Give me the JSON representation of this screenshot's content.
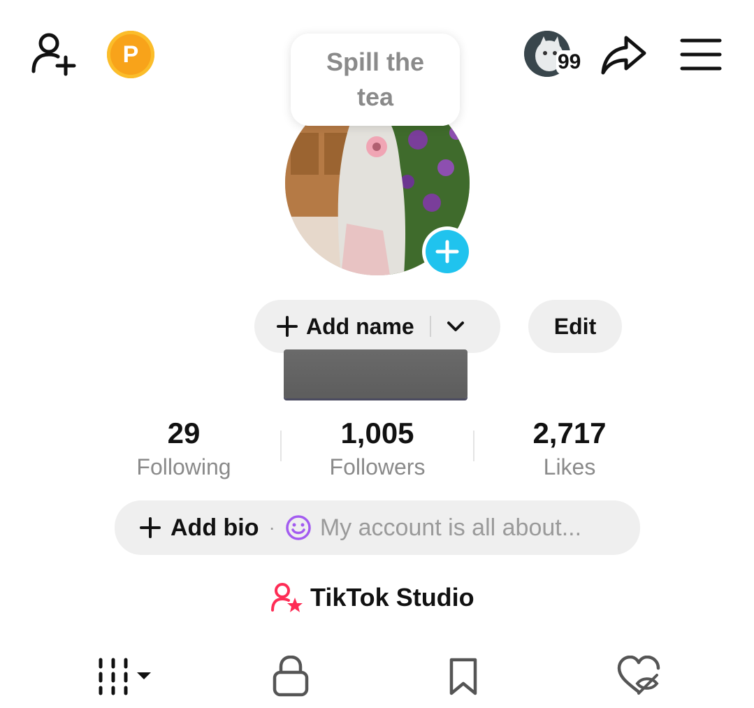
{
  "tooltip": {
    "text": "Spill the tea"
  },
  "header": {
    "story_count": "99"
  },
  "profile": {
    "add_name_label": "Add name",
    "edit_label": "Edit"
  },
  "stats": [
    {
      "value": "29",
      "label": "Following"
    },
    {
      "value": "1,005",
      "label": "Followers"
    },
    {
      "value": "2,717",
      "label": "Likes"
    }
  ],
  "bio": {
    "add_label": "Add bio",
    "separator": "·",
    "placeholder": "My account is all about..."
  },
  "studio": {
    "label": "TikTok Studio"
  },
  "colors": {
    "accent_blue": "#20c3ee",
    "coin_orange": "#f8a31a",
    "studio_pink": "#fe2c55",
    "emoji_purple": "#a35cf0"
  },
  "icons": {
    "top": [
      "add-user-icon",
      "coin-icon",
      "share-icon",
      "menu-icon"
    ],
    "tabs": [
      "grid-icon",
      "lock-icon",
      "bookmark-icon",
      "liked-hidden-icon"
    ]
  }
}
